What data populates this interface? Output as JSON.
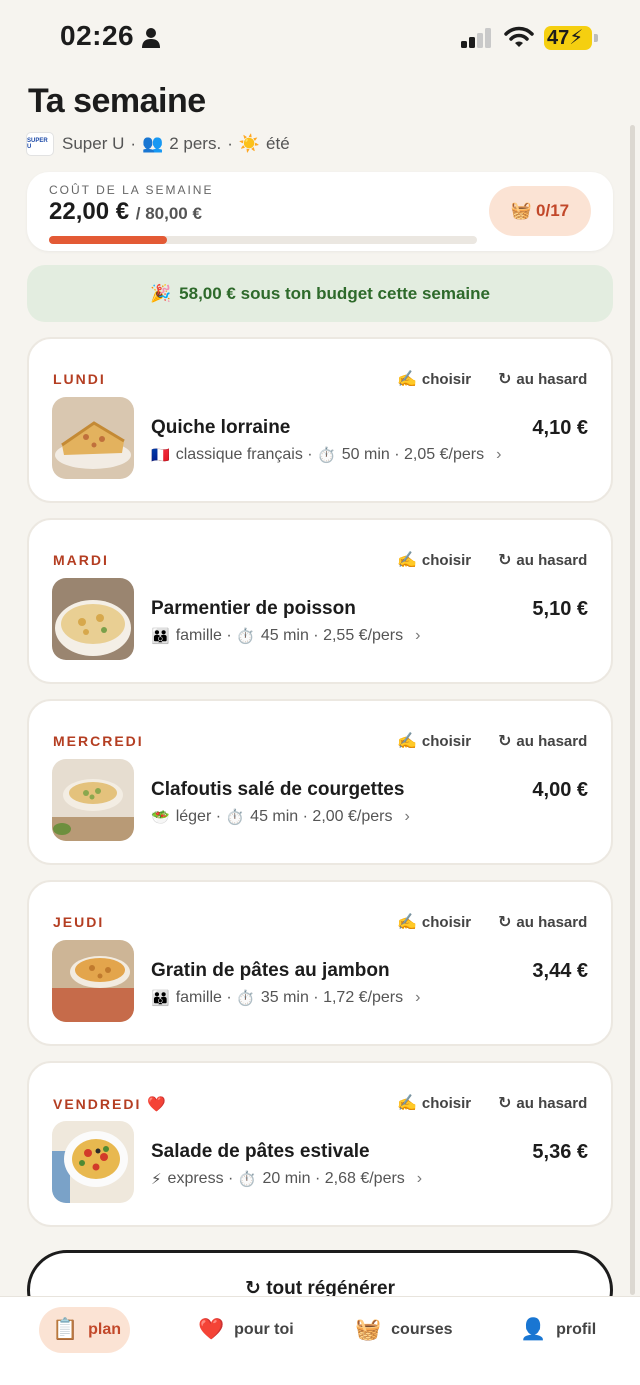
{
  "status_bar": {
    "time": "02:26",
    "battery": "47"
  },
  "header": {
    "title": "Ta semaine",
    "store_logo_text": "SUPER U",
    "store": "Super U",
    "people": "2 pers.",
    "season": "été"
  },
  "cost": {
    "label": "COÛT DE LA SEMAINE",
    "spent": "22,00 €",
    "budget": "/ 80,00 €",
    "progress_fraction": 0.275,
    "basket": "0/17"
  },
  "banner": {
    "text": "58,00 € sous ton budget cette semaine"
  },
  "actions": {
    "choose": "choisir",
    "random": "au hasard"
  },
  "days": [
    {
      "day": "LUNDI",
      "meal": "Quiche lorraine",
      "price": "4,10 €",
      "tag_icon": "🇫🇷",
      "tag": "classique français",
      "time": "50 min",
      "per_person": "2,05 €/pers",
      "favorite": false
    },
    {
      "day": "MARDI",
      "meal": "Parmentier de poisson",
      "price": "5,10 €",
      "tag_icon": "👪",
      "tag": "famille",
      "time": "45 min",
      "per_person": "2,55 €/pers",
      "favorite": false
    },
    {
      "day": "MERCREDI",
      "meal": "Clafoutis salé de courgettes",
      "price": "4,00 €",
      "tag_icon": "🥗",
      "tag": "léger",
      "time": "45 min",
      "per_person": "2,00 €/pers",
      "favorite": false
    },
    {
      "day": "JEUDI",
      "meal": "Gratin de pâtes au jambon",
      "price": "3,44 €",
      "tag_icon": "👪",
      "tag": "famille",
      "time": "35 min",
      "per_person": "1,72 €/pers",
      "favorite": false
    },
    {
      "day": "VENDREDI",
      "meal": "Salade de pâtes estivale",
      "price": "5,36 €",
      "tag_icon": "⚡",
      "tag": "express",
      "time": "20 min",
      "per_person": "2,68 €/pers",
      "favorite": true
    }
  ],
  "regenerate": {
    "label": "tout régénérer"
  },
  "tabs": {
    "plan": "plan",
    "for_you": "pour toi",
    "courses": "courses",
    "profil": "profil"
  },
  "colors": {
    "accent": "#e35a35",
    "day_label": "#b43e22",
    "banner_bg": "#e3ede0",
    "banner_text": "#2e6a2b",
    "background": "#f6f4ef"
  }
}
